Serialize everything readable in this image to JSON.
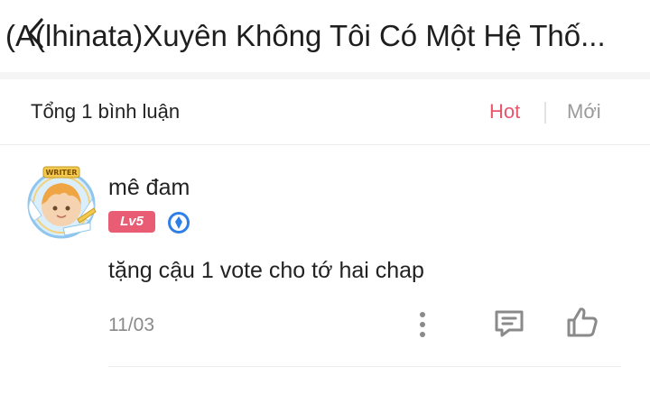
{
  "header": {
    "title": "(A(lhinata)Xuyên Không Tôi Có Một Hệ Thố..."
  },
  "comments_bar": {
    "total_label": "Tổng 1 bình luận",
    "sort_hot": "Hot",
    "sort_new": "Mới",
    "accent_color": "#e8566e"
  },
  "comment": {
    "username": "mê đam",
    "level": "Lv5",
    "avatar_badge_text": "WRITER",
    "text": "tặng cậu 1 vote cho tớ hai chap",
    "date": "11/03"
  }
}
